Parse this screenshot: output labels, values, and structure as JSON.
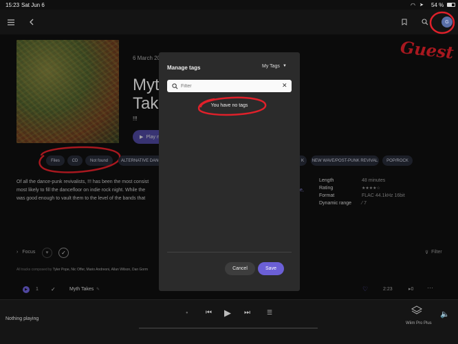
{
  "status_bar": {
    "time": "15:23",
    "date": "Sat Jun 6",
    "battery": "54 %"
  },
  "top_nav": {
    "avatar_letter": "G"
  },
  "annotation": {
    "guest_label": "Guest"
  },
  "album": {
    "date": "6 March 20",
    "title_line1": "Myt",
    "title_line2": "Tak",
    "artist": "!!!",
    "play_label": "Play n",
    "tags_left": [
      "Files",
      "CD",
      "Not found"
    ],
    "genres": [
      "ALTERNATIVE DANCE",
      "K",
      "NEW WAVE/POST-PUNK REVIVAL",
      "POP/ROCK"
    ],
    "description": [
      "Of all the dance-punk revivalists, !!! has been the most consist",
      "most likely to fill the dancefloor on indie rock night. While the",
      "was good enough to vault them to the level of the bands that"
    ],
    "desc_fragment": "e,",
    "meta": [
      {
        "label": "Length",
        "value": "48 minutes"
      },
      {
        "label": "Rating",
        "value": "★★★★☆"
      },
      {
        "label": "Format",
        "value": "FLAC 44.1kHz 16bit"
      },
      {
        "label": "Dynamic range",
        "value": "⁄ 7"
      }
    ],
    "focus_label": "Focus",
    "filter_label": "Filter",
    "credits_prefix": "All tracks composed by",
    "credits_names": "Tyler Pope, Nic Offer, Mario Andreoni, Allan Wilson, Dan Gorm"
  },
  "track": {
    "number": "1",
    "title": "Myth Takes",
    "duration": "2:23"
  },
  "player": {
    "status": "Nothing playing",
    "device": "Wiim Pro Plus"
  },
  "modal": {
    "title": "Manage tags",
    "dropdown_label": "My Tags",
    "filter_placeholder": "Filter",
    "empty_message": "You have no tags",
    "cancel_label": "Cancel",
    "save_label": "Save"
  },
  "colors": {
    "accent": "#6b5fd6",
    "annotation": "#e0202a",
    "chip_bg": "#262a36"
  }
}
